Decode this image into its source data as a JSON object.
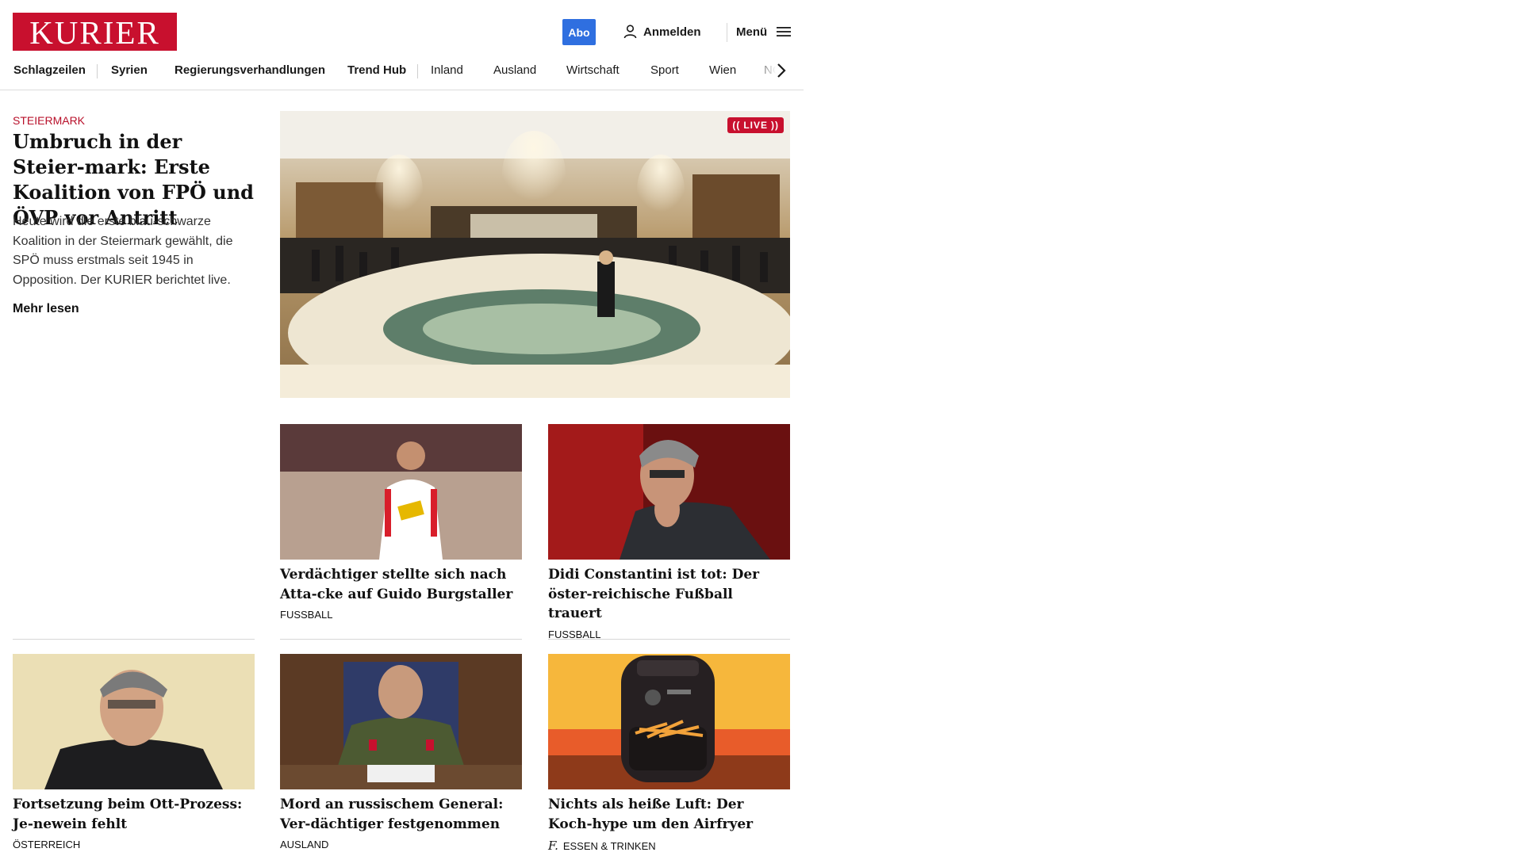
{
  "header": {
    "logo": "KURIER",
    "abo_label": "Abo",
    "login_label": "Anmelden",
    "menu_label": "Menü"
  },
  "nav": {
    "items": [
      {
        "label": "Schlagzeilen",
        "bold": true
      },
      {
        "label": "Syrien",
        "bold": true
      },
      {
        "label": "Regierungsverhandlungen",
        "bold": true
      },
      {
        "label": "Trend Hub",
        "bold": true
      },
      {
        "label": "Inland",
        "bold": false
      },
      {
        "label": "Ausland",
        "bold": false
      },
      {
        "label": "Wirtschaft",
        "bold": false
      },
      {
        "label": "Sport",
        "bold": false
      },
      {
        "label": "Wien",
        "bold": false
      },
      {
        "label": "NÖ",
        "bold": false
      }
    ]
  },
  "lead": {
    "kicker": "STEIERMARK",
    "title": "Umbruch in der Steier-mark: Erste Koalition von FPÖ und ÖVP vor Antritt",
    "teaser": "Heute wird die erste blau-schwarze Koalition in der Steiermark gewählt, die SPÖ muss erstmals seit 1945 in Opposition. Der KURIER berichtet live.",
    "more_label": "Mehr lesen",
    "live_label": "LIVE"
  },
  "cards": [
    {
      "title": "Verdächtiger stellte sich nach Atta-cke auf Guido Burgstaller",
      "category": "FUSSBALL"
    },
    {
      "title": "Didi Constantini ist tot: Der öster-reichische Fußball trauert",
      "category": "FUSSBALL"
    },
    {
      "title": "Fortsetzung beim Ott-Prozess: Je-newein fehlt",
      "category": "ÖSTERREICH"
    },
    {
      "title": "Mord an russischem General: Ver-dächtiger festgenommen",
      "category": "AUSLAND"
    },
    {
      "title": "Nichts als heiße Luft: Der Koch-hype um den Airfryer",
      "category": "ESSEN & TRINKEN",
      "brand_glyph": "f."
    }
  ],
  "colors": {
    "brand_red": "#c8102e",
    "abo_blue": "#2f6fe0",
    "kicker_red": "#b8102a"
  }
}
